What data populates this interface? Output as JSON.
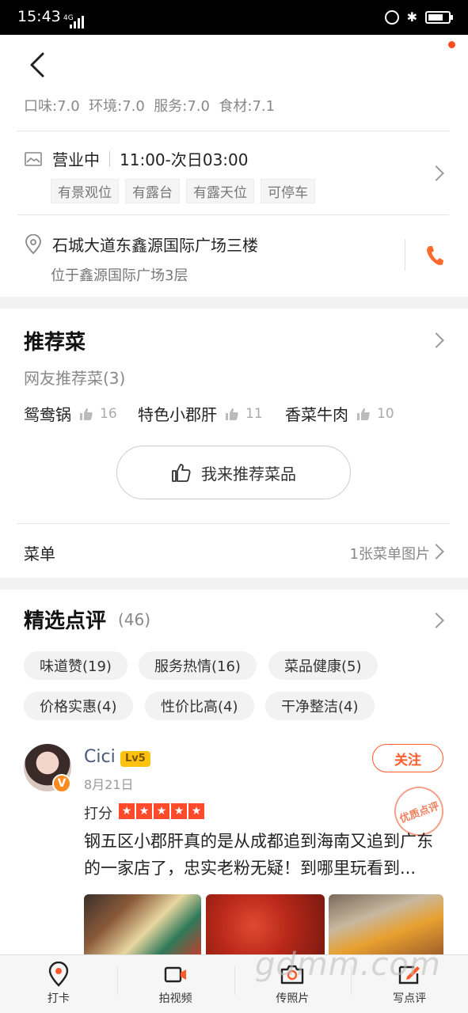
{
  "status_bar": {
    "time": "15:43",
    "network": "4G"
  },
  "ratings": {
    "text": "口味:7.0  环境:7.0  服务:7.0  食材:7.1"
  },
  "business": {
    "status": "营业中",
    "hours": "11:00-次日03:00",
    "tags": [
      "有景观位",
      "有露台",
      "有露天位",
      "可停车"
    ]
  },
  "address": {
    "main": "石城大道东鑫源国际广场三楼",
    "sub": "位于鑫源国际广场3层"
  },
  "recommended": {
    "title": "推荐菜",
    "subtitle": "网友推荐菜(3)",
    "dishes": [
      {
        "name": "鸳鸯锅",
        "likes": "16"
      },
      {
        "name": "特色小郡肝",
        "likes": "11"
      },
      {
        "name": "香菜牛肉",
        "likes": "10"
      }
    ],
    "button": "我来推荐菜品"
  },
  "menu": {
    "label": "菜单",
    "info": "1张菜单图片"
  },
  "reviews": {
    "title": "精选点评",
    "count": "(46)",
    "tags": [
      "味道赞(19)",
      "服务热情(16)",
      "菜品健康(5)",
      "价格实惠(4)",
      "性价比高(4)",
      "干净整洁(4)"
    ],
    "item": {
      "username": "Cici",
      "level": "Lv5",
      "verified": "V",
      "date": "8月21日",
      "follow": "关注",
      "stamp": "优质点评",
      "rate_label": "打分",
      "stars": 5,
      "text": "钢五区小郡肝真的是从成都追到海南又追到广东的一家店了，忠实老粉无疑！到哪里玩看到..."
    }
  },
  "tab_bar": {
    "tabs": [
      {
        "label": "打卡",
        "icon": "pin-icon"
      },
      {
        "label": "拍视频",
        "icon": "video-icon"
      },
      {
        "label": "传照片",
        "icon": "camera-icon"
      },
      {
        "label": "写点评",
        "icon": "edit-icon"
      }
    ]
  },
  "watermark": "gdmm.com",
  "colors": {
    "accent": "#ff5a2a",
    "star": "#ff4b2b",
    "level": "#ffc20e"
  }
}
